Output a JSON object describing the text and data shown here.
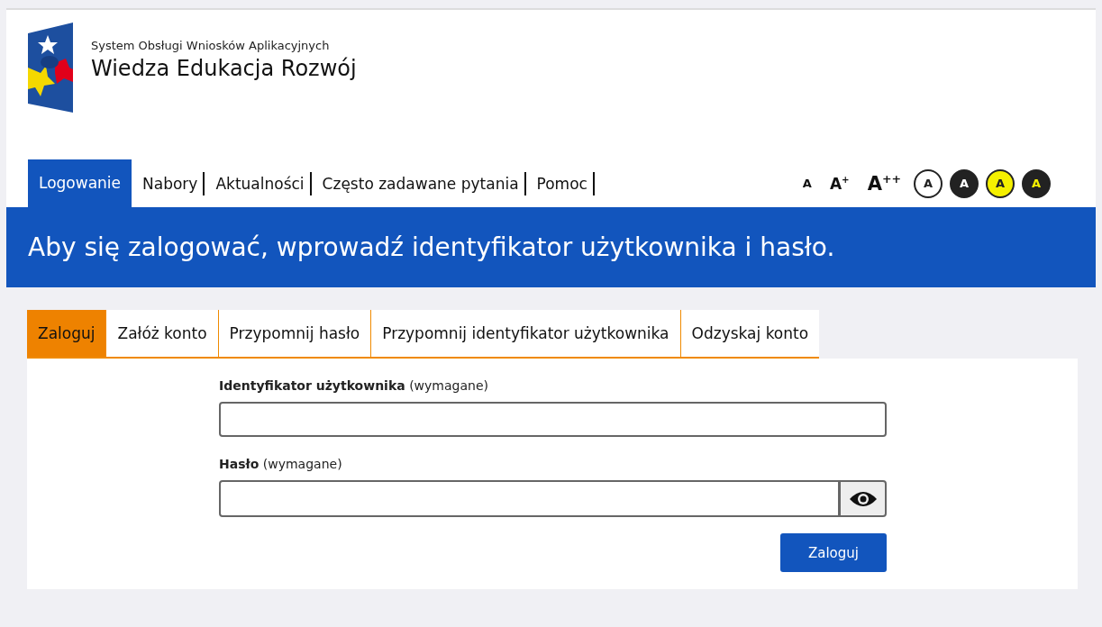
{
  "header": {
    "subtitle": "System Obsługi Wniosków Aplikacyjnych",
    "title": "Wiedza Edukacja Rozwój"
  },
  "nav": [
    {
      "label": "Logowanie",
      "selected": true
    },
    {
      "label": "Nabory",
      "selected": false
    },
    {
      "label": "Aktualności",
      "selected": false
    },
    {
      "label": "Często zadawane pytania",
      "selected": false
    },
    {
      "label": "Pomoc",
      "selected": false
    }
  ],
  "font_sizes": [
    {
      "label": "A",
      "kind": "small"
    },
    {
      "label": "A$^{+}$",
      "kind": "medium"
    },
    {
      "label": "A$^{++}$",
      "kind": "large"
    }
  ],
  "contrast": [
    {
      "label": "A",
      "kind": "outline"
    },
    {
      "label": "A",
      "kind": "dark"
    },
    {
      "label": "A",
      "kind": "yellow"
    },
    {
      "label": "A",
      "kind": "dark-yellow"
    }
  ],
  "banner": "Aby się zalogować, wprowadź identyfikator użytkownika i hasło.",
  "tabs": [
    {
      "label": "Zaloguj",
      "selected": true
    },
    {
      "label": "Załóż konto",
      "selected": false
    },
    {
      "label": "Przypomnij hasło",
      "selected": false
    },
    {
      "label": "Przypomnij identyfikator użytkownika",
      "selected": false
    },
    {
      "label": "Odzyskaj konto",
      "selected": false
    }
  ],
  "fields": [
    {
      "label": "**Identyfikator użytkownika** (wymagane)",
      "kind": "text"
    },
    {
      "label": "**Hasło** (wymagane)",
      "kind": "password"
    }
  ],
  "submit": "Zaloguj"
}
